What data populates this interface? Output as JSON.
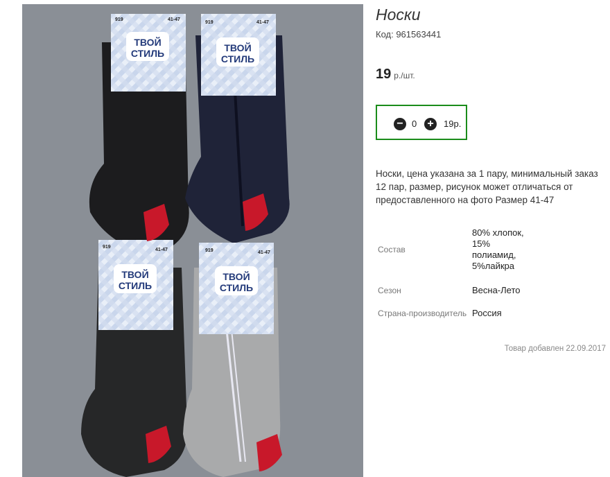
{
  "product": {
    "title": "Носки",
    "code": "Код: 961563441",
    "price_value": "19",
    "price_unit": "р./шт.",
    "description": "Носки, цена указана за 1 пару, минимальный заказ 12 пар, размер, рисунок может отличаться от предоставленного на фото Размер 41-47",
    "added": "Товар добавлен 22.09.2017"
  },
  "cart": {
    "minus": "−",
    "plus": "+",
    "quantity": "0",
    "sum": "19р.",
    "border_color": "#1a8c1a"
  },
  "properties": [
    {
      "label": "Состав",
      "value": "80% хлопок, 15% полиамид, 5%лайкра"
    },
    {
      "label": "Сезон",
      "value": "Весна-Лето"
    },
    {
      "label": "Страна-производитель",
      "value": "Россия"
    }
  ],
  "photo": {
    "label_brand_line1": "ТВОЙ",
    "label_brand_line2": "СТИЛЬ",
    "label_model": "919",
    "label_size": "41-47",
    "sock_colors": [
      "#1c1c1e",
      "#1f2338",
      "#262728",
      "#a9aaab"
    ]
  }
}
